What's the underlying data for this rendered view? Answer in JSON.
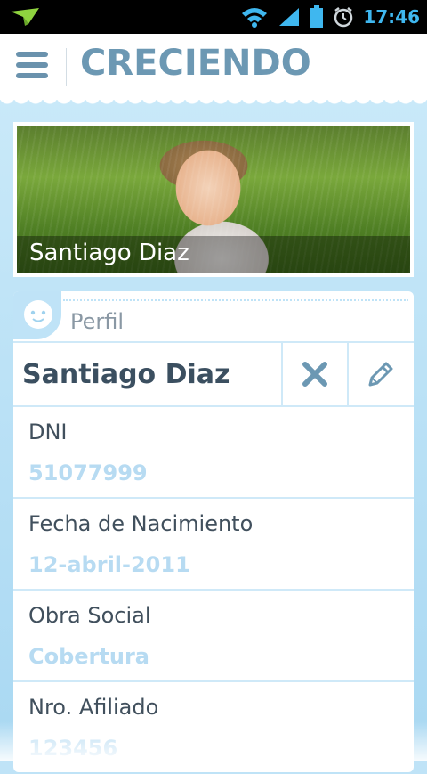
{
  "status_bar": {
    "time": "17:46"
  },
  "app": {
    "title": "CRECIENDO"
  },
  "hero": {
    "name": "Santiago Diaz"
  },
  "profile": {
    "section_label": "Perfil",
    "name": "Santiago Diaz",
    "fields": [
      {
        "label": "DNI",
        "value": "51077999"
      },
      {
        "label": "Fecha de Nacimiento",
        "value": "12-abril-2011"
      },
      {
        "label": "Obra Social",
        "value": "Cobertura"
      },
      {
        "label": "Nro. Afiliado",
        "value": "123456"
      }
    ]
  },
  "colors": {
    "accent": "#6c98b3",
    "time": "#3fb7ef",
    "value": "#b7dbf2",
    "background": "#bfe3f7"
  },
  "icons": [
    "notification-app-icon",
    "wifi-icon",
    "signal-icon",
    "battery-icon",
    "alarm-icon",
    "menu-icon",
    "baby-face-icon",
    "close-icon",
    "pencil-icon"
  ]
}
